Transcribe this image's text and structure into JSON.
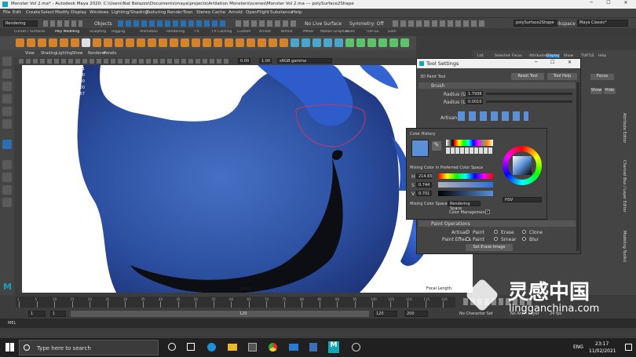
{
  "window": {
    "title": "Monster Vol 2.ma* - Autodesk Maya 2020: C:\\Users\\Nat Belazzo\\Documents\\maya\\projects\\Artilation Monsters\\scenes\\Monster Vol 2.ma  ---  polySurface2Shape"
  },
  "menu": [
    "File",
    "Edit",
    "Create",
    "Select",
    "Modify",
    "Display",
    "Windows",
    "Lighting/Shading",
    "Texturing",
    "Render",
    "Toon",
    "Stereo",
    "Cache",
    "Arnold",
    "OpenFlight",
    "Substance",
    "Help"
  ],
  "status": {
    "mode": "Rendering",
    "objects": "Objects",
    "no_live": "No Live Surface",
    "symmetry": "Symmetry: Off",
    "workspace_label": "Workspace :",
    "workspace": "Maya Classic*",
    "field": "polySurface2Shape"
  },
  "shelf_tabs": [
    "Curves / Surfaces",
    "Poly Modeling",
    "Sculpting",
    "Rigging",
    "Animation",
    "Rendering",
    "FX",
    "FX Caching",
    "Custom",
    "Arnold",
    "Bifrost",
    "MASH",
    "Motion Graphics",
    "XGen",
    "TURTLE",
    "Gam"
  ],
  "viewport": {
    "menu": [
      "View",
      "Shading",
      "Lighting",
      "Show",
      "Renderer",
      "Panels"
    ],
    "field1": "0.00",
    "field2": "1.00",
    "colorspace": "sRGB gamma",
    "hud": [
      [
        "Verts:",
        "63281",
        "60761"
      ],
      [
        "Edges:",
        "126364",
        "92300"
      ],
      [
        "Faces:",
        "63112",
        "46600"
      ],
      [
        "Tris:",
        "126324",
        "93200"
      ],
      [
        "UVs:",
        "68447",
        "48067"
      ]
    ],
    "camera": "persp",
    "focal": "Focal Length:"
  },
  "rightpanel": {
    "tabs": [
      "List",
      "Selected",
      "Focus",
      "Attributes",
      "Display",
      "Show",
      "TURTLE",
      "Help"
    ],
    "focus_btn": "Focus",
    "show_btn": "Show",
    "hide_btn": "Hide",
    "vtabs": [
      "Attribute Editor",
      "Channel Box / Layer Editor",
      "Modeling Toolkit"
    ]
  },
  "tool_settings": {
    "title": "Tool Settings",
    "tool": "3D Paint Tool",
    "reset": "Reset Tool",
    "help": "Tool Help",
    "brush": "Brush",
    "radius_u_label": "Radius (U)",
    "radius_u": "1.7936",
    "radius_l_label": "Radius (L)",
    "radius_l": "0.0010",
    "artisan": "Artisan",
    "paint_ops": "Paint Operations",
    "artisan2": "Artisan",
    "paint": "Paint",
    "erase": "Erase",
    "clone": "Clone",
    "paint_effects": "Paint Effects",
    "paint2": "Paint",
    "smear": "Smear",
    "blur": "Blur",
    "erase_image": "Set Erase Image"
  },
  "color_popup": {
    "history": "Color History",
    "mixing_label": "Mixing Color in Preferred Color Space",
    "h_label": "H",
    "h": "214.65",
    "s_label": "S",
    "s": "0.744",
    "v_label": "V",
    "v": "0.701",
    "mixing_space_label": "Mixing Color Space:",
    "mixing_space": "Rendering Space",
    "mode": "HSV",
    "cm_label": "Color Management",
    "swatch": "#5b8fd6"
  },
  "timeline": {
    "ticks": [
      "1",
      "5",
      "10",
      "15",
      "20",
      "25",
      "30",
      "35",
      "40",
      "45",
      "50",
      "55",
      "60",
      "65",
      "70",
      "75",
      "80",
      "85",
      "90",
      "95",
      "100",
      "105",
      "110",
      "115",
      "120"
    ],
    "start": "1",
    "end": "120",
    "range_end": "120",
    "total": "200",
    "no_char": "No Character Set",
    "no_anim": "No Anim Layer",
    "fps": "24 fps"
  },
  "mel": {
    "label": "MEL"
  },
  "taskbar": {
    "search": "Type here to search",
    "lang": "ENG",
    "time": "23:17",
    "date": "11/02/2021"
  },
  "watermark": {
    "cn": "灵感中国",
    "url": "lingganchina.com"
  }
}
